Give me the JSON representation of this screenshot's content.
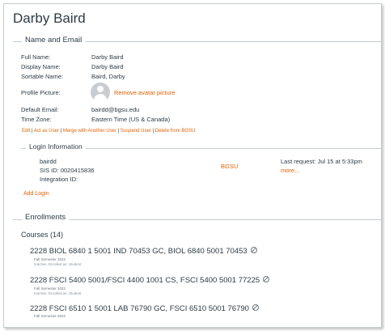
{
  "user": {
    "page_title": "Darby Baird"
  },
  "name_email": {
    "legend": "Name and Email",
    "rows": [
      {
        "label": "Full Name:",
        "value": "Darby Baird"
      },
      {
        "label": "Display Name:",
        "value": "Darby Baird"
      },
      {
        "label": "Sortable Name:",
        "value": "Baird, Darby"
      },
      {
        "label": "Profile Picture:",
        "value": "Remove avatar picture"
      },
      {
        "label": "Default Email:",
        "value": "bairdd@bgsu.edu"
      },
      {
        "label": "Time Zone:",
        "value": "Eastern Time (US & Canada)"
      }
    ],
    "actions": [
      "Edit",
      "Act as User",
      "Merge with Another User",
      "Suspend User",
      "Delete from BGSU"
    ],
    "separator": " | "
  },
  "login": {
    "legend": "Login Information",
    "username": "bairdd",
    "sis_id": "SIS ID: 0020415836",
    "integration_id": "Integration ID:",
    "account": "BGSU",
    "last_request": "Last request: Jul 15 at 5:33pm",
    "more": "more...",
    "add_login": "Add Login"
  },
  "enrollments": {
    "legend": "Enrollments",
    "courses_heading": "Courses (14)",
    "courses": [
      {
        "title": "2228 BIOL 6840 1 5001 IND 70453 GC, BIOL 6840 5001 70453",
        "term": "Fall Semester 2022",
        "status": "Inactive, Enrolled as: Student",
        "icon": "unpublished-icon"
      },
      {
        "title": "2228 FSCI 5400 5001/FSCI 4400 1001 CS, FSCI 5400 5001 77225",
        "term": "Fall Semester 2022",
        "status": "Inactive, Enrolled as: Student",
        "icon": "unpublished-icon"
      },
      {
        "title": "2228 FSCI 6510 1 5001 LAB 76790 GC, FSCI 6510 5001 76790",
        "term": "Fall Semester 2022",
        "status": "",
        "icon": "unpublished-icon"
      }
    ]
  },
  "colors": {
    "link": "#e66000",
    "text": "#2d3b45",
    "border": "#c7cdd1"
  }
}
